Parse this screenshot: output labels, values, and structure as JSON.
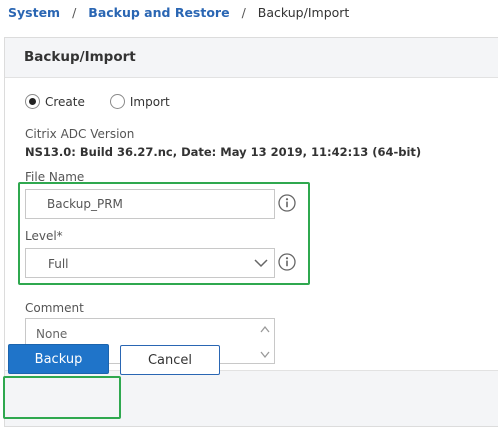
{
  "breadcrumb": {
    "items": [
      "System",
      "Backup and Restore",
      "Backup/Import"
    ],
    "separator": "/"
  },
  "panel": {
    "title": "Backup/Import"
  },
  "mode": {
    "options": [
      "Create",
      "Import"
    ],
    "selected": "Create"
  },
  "version": {
    "label": "Citrix ADC Version",
    "value": "NS13.0: Build 36.27.nc, Date: May 13 2019, 11:42:13 (64-bit)"
  },
  "file_name": {
    "label": "File Name",
    "value": "Backup_PRM"
  },
  "level": {
    "label": "Level*",
    "value": "Full"
  },
  "comment": {
    "label": "Comment",
    "placeholder": "None"
  },
  "actions": {
    "backup_label": "Backup",
    "cancel_label": "Cancel"
  },
  "colors": {
    "link": "#2a66b3",
    "primary": "#1f74c9",
    "highlight": "#2fa84f"
  }
}
